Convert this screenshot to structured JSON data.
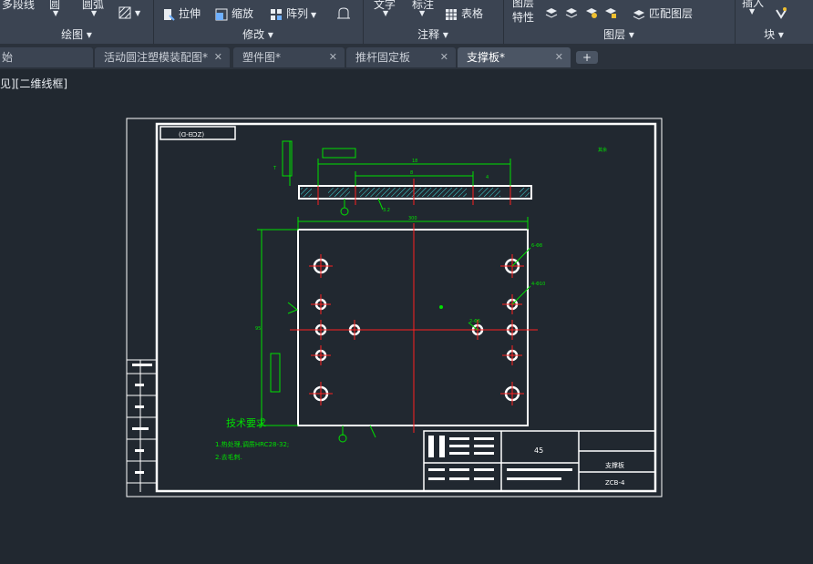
{
  "ribbon": {
    "draw_items": [
      "多段线",
      "圆",
      "圆弧"
    ],
    "modify_items": [
      "拉伸",
      "缩放",
      "阵列"
    ],
    "annot_items": [
      "文字",
      "标注",
      "表格"
    ],
    "layer_items": [
      "图层",
      "特性",
      "匹配图层"
    ],
    "insert_label": "插入",
    "groups": {
      "draw": "绘图 ▾",
      "modify": "修改 ▾",
      "annot": "注释 ▾",
      "layers": "图层 ▾",
      "block": "块 ▾"
    }
  },
  "tabs": [
    {
      "label": "始"
    },
    {
      "label": "活动圆注塑模装配图*"
    },
    {
      "label": "塑件图*"
    },
    {
      "label": "推杆固定板"
    },
    {
      "label": "支撑板*"
    }
  ],
  "viewport_label": "见][二维线框]",
  "drawing": {
    "tech_req_title": "技术要求",
    "tech_req_1": "1.热处理,调质HRC28-32;",
    "tech_req_2": "2.去毛刺.",
    "material": "45",
    "part_name": "支撑板",
    "drawing_no": "ZCB-4"
  },
  "colors": {
    "model_bg": "#212830",
    "sheet_line": "#ffffff",
    "center_line": "#ff2020",
    "dim_green": "#00e000",
    "hatch_cyan": "#40e0e0"
  }
}
